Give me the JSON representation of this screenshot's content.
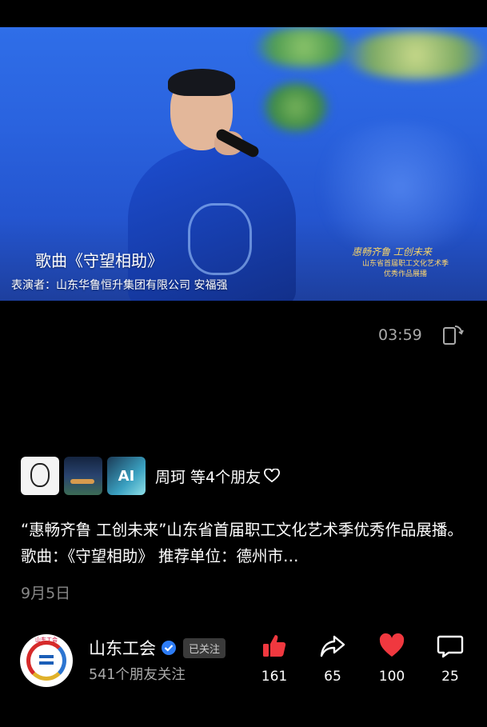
{
  "video": {
    "song_title": "歌曲《守望相助》",
    "credit": "表演者：山东华鲁恒升集团有限公司 安福强",
    "slogan": "惠畅齐鲁  工创未来",
    "org_line1": "山东省首届职工文化艺术季",
    "org_line2": "优秀作品展播",
    "duration": "03:59"
  },
  "friends": {
    "text": "周珂 等4个朋友",
    "avatar3_label": "AI"
  },
  "post": {
    "description": "“惠畅齐鲁 工创未来”山东省首届职工文化艺术季优秀作品展播。歌曲：《守望相助》 推荐单位：德州市…",
    "date": "9月5日"
  },
  "account": {
    "avatar_text": "山东工会",
    "name": "山东工会",
    "follow_status": "已关注",
    "followers": "541个朋友关注"
  },
  "actions": {
    "like_count": "161",
    "share_count": "65",
    "favorite_count": "100",
    "comment_count": "25"
  },
  "colors": {
    "like": "#f0383f",
    "favorite": "#f0383f",
    "verified": "#2d7cf5"
  }
}
